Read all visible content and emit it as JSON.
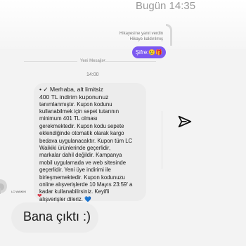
{
  "header": {
    "time": "Bugün 14:35"
  },
  "thread": {
    "story_reply_note_1": "Hikayesine yanıt verdin",
    "story_reply_note_2": "Hikaye kaldırılmış",
    "sent_message": "Şifre:😢🎁",
    "new_messages_label": "Yeni Mesajlar",
    "received_time": "14:00",
    "received_message_lines": [
      "• ✓ Merhaba, alt limitsiz",
      "400 TL indirim kuponunuz",
      "tanımlanmıştır. Kupon kodunu",
      "kullanabilmek için sepet tutarının",
      "minimum 401 TL olması",
      "gerekmektedir. Kupon kodu sepete",
      "eklendiğinde otomatik olarak kargo",
      "bedava uygulanacaktır. Kupon tüm LC",
      "Waikiki ürünlerinde geçerlidir,",
      "markalar dahil değildir. Kampanya",
      "mobil uygulamada ve web sitesinde",
      "geçerlidir. Yeni üye indirimi ile",
      "birleşmemektedir. Kupon kodunuzu",
      "online alışverişlerde 10 Mayıs 23:59' a",
      "kadar kullanabilirsiniz. Keyifli",
      "alışverişler dileriz. 💙"
    ],
    "received_heart": "❤",
    "sender_tag": "LC WAIKIKI",
    "reply_text": "Bana çıktı :)"
  },
  "icons": {
    "send": "send-icon"
  },
  "colors": {
    "sent_bubble": "#7c59f0",
    "received_bubble": "#ececec",
    "background": "#f3f3f3"
  }
}
